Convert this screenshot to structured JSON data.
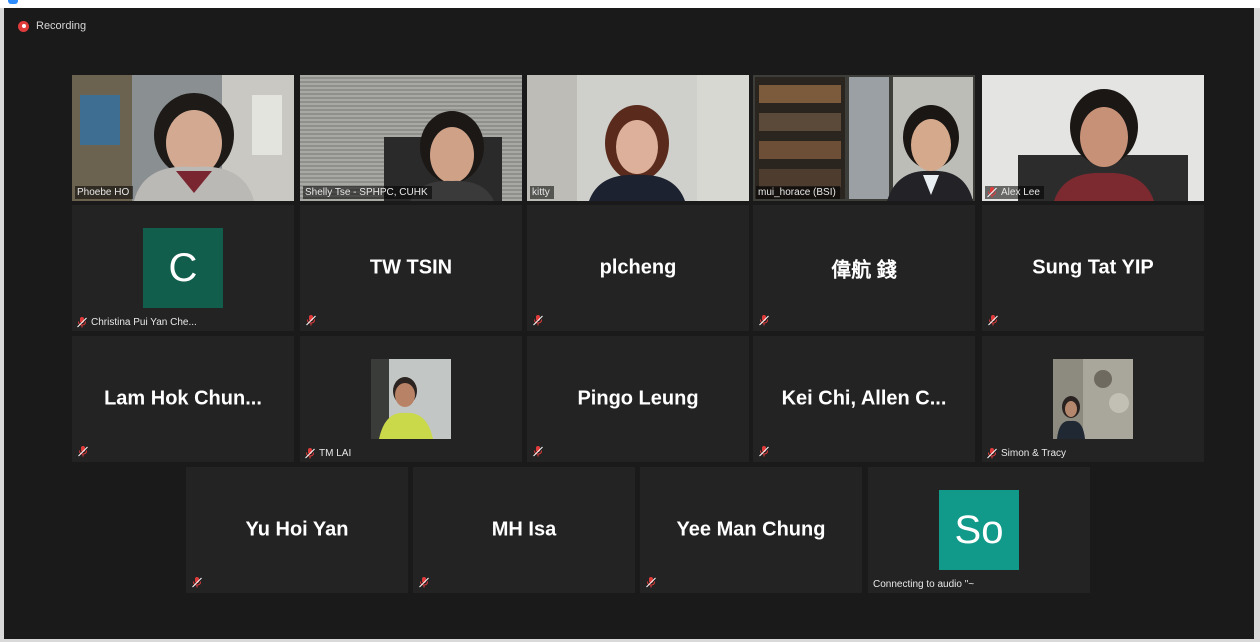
{
  "recording": {
    "label": "Recording"
  },
  "colors": {
    "background": "#1a1a1a",
    "tile": "#232323",
    "active_speaker_outline": "#c8e06a",
    "mute_red": "#e03b3b",
    "avatar_christina": "#115e4c",
    "avatar_so": "#119a8a"
  },
  "row1": [
    {
      "name": "Phoebe HO",
      "video": true
    },
    {
      "name": "Shelly Tse - SPHPC, CUHK",
      "video": true
    },
    {
      "name": "kitty",
      "video": true
    },
    {
      "name": "mui_horace (BSI)",
      "video": true,
      "active_speaker": true
    },
    {
      "name": "Alex Lee",
      "video": true,
      "muted": true
    }
  ],
  "row2": [
    {
      "avatar_letter": "C",
      "name": "Christina Pui Yan Che..."
    },
    {
      "display": "TW TSIN"
    },
    {
      "display": "plcheng"
    },
    {
      "display": "偉航 錢"
    },
    {
      "display": "Sung Tat YIP"
    }
  ],
  "row3": [
    {
      "display": "Lam Hok Chun..."
    },
    {
      "name": "TM LAI",
      "thumb": true
    },
    {
      "display": "Pingo Leung"
    },
    {
      "display": "Kei Chi, Allen C..."
    },
    {
      "name": "Simon & Tracy",
      "thumb": true
    }
  ],
  "row4": [
    {
      "display": "Yu Hoi Yan"
    },
    {
      "display": "MH Isa"
    },
    {
      "display": "Yee Man Chung"
    },
    {
      "avatar_letter": "So",
      "name": "Connecting to audio  \"~"
    }
  ],
  "icons": {
    "mute": "muted-microphone-icon",
    "record": "record-icon"
  }
}
